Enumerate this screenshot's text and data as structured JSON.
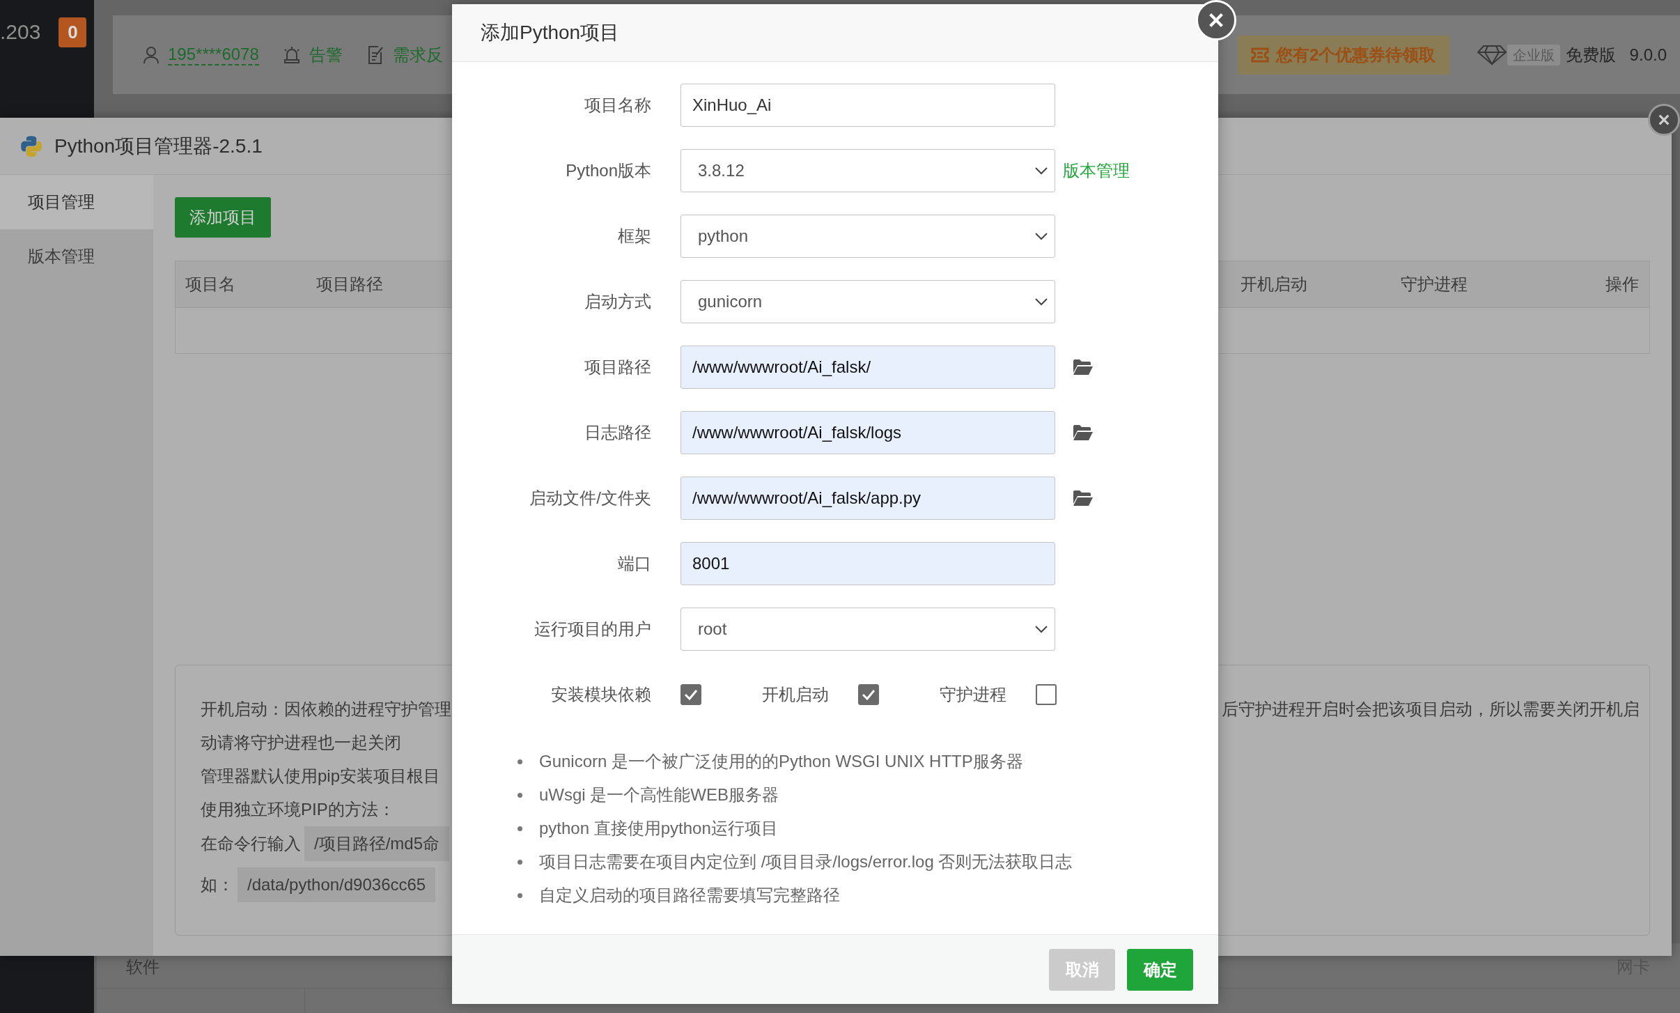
{
  "app_sidebar": {
    "address_fragment": ".203",
    "badge": "0"
  },
  "header": {
    "user": "195****6078",
    "links": [
      {
        "label": "告警"
      },
      {
        "label": "需求反"
      }
    ],
    "coupon": "您有2个优惠券待领取",
    "edition_badge": "企业版",
    "edition": "免费版",
    "version": "9.0.0"
  },
  "manager": {
    "title": "Python项目管理器-2.5.1",
    "sidebar": {
      "items": [
        {
          "label": "项目管理",
          "selected": true
        },
        {
          "label": "版本管理",
          "selected": false
        }
      ]
    },
    "add_button": "添加项目",
    "table": {
      "columns": [
        "项目名",
        "项目路径",
        "开机启动",
        "守护进程",
        "操作"
      ]
    },
    "notes": [
      {
        "text": "开机启动：因依赖的进程守护管理",
        "text_right": "后守护进程开启时会把该项目启动，所以需要关闭开机启"
      },
      {
        "text": "动请将守护进程也一起关闭"
      },
      {
        "text": "管理器默认使用pip安装项目根目"
      },
      {
        "text": "使用独立环境PIP的方法："
      },
      {
        "text": "在命令行输入",
        "code": "/项目路径/md5命"
      },
      {
        "text": "如：",
        "code": "/data/python/d9036cc65"
      }
    ]
  },
  "dialog": {
    "title": "添加Python项目",
    "fields": [
      {
        "kind": "text",
        "label": "项目名称",
        "value": "XinHuo_Ai",
        "autofilled": false
      },
      {
        "kind": "select",
        "label": "Python版本",
        "value": "3.8.12",
        "autofilled": false,
        "link": "版本管理"
      },
      {
        "kind": "select",
        "label": "框架",
        "value": "python",
        "autofilled": false
      },
      {
        "kind": "select",
        "label": "启动方式",
        "value": "gunicorn",
        "autofilled": false
      },
      {
        "kind": "path",
        "label": "项目路径",
        "value": "/www/wwwroot/Ai_falsk/",
        "autofilled": true
      },
      {
        "kind": "path",
        "label": "日志路径",
        "value": "/www/wwwroot/Ai_falsk/logs",
        "autofilled": true
      },
      {
        "kind": "path",
        "label": "启动文件/文件夹",
        "value": "/www/wwwroot/Ai_falsk/app.py",
        "autofilled": true
      },
      {
        "kind": "text",
        "label": "端口",
        "value": "8001",
        "autofilled": true
      },
      {
        "kind": "select",
        "label": "运行项目的用户",
        "value": "root",
        "autofilled": false
      }
    ],
    "checkboxes": [
      {
        "label": "安装模块依赖",
        "checked": true
      },
      {
        "label": "开机启动",
        "checked": true
      },
      {
        "label": "守护进程",
        "checked": false
      }
    ],
    "tips": [
      "Gunicorn 是一个被广泛使用的的Python WSGI UNIX HTTP服务器",
      "uWsgi 是一个高性能WEB服务器",
      "python 直接使用python运行项目",
      "项目日志需要在项目内定位到 /项目目录/logs/error.log 否则无法获取日志",
      "自定义启动的项目路径需要填写完整路径"
    ],
    "buttons": [
      {
        "kind": "cancel",
        "label": "取消"
      },
      {
        "kind": "confirm",
        "label": "确定"
      }
    ]
  },
  "background_card": {
    "labels": [
      "软件",
      "网卡"
    ]
  }
}
